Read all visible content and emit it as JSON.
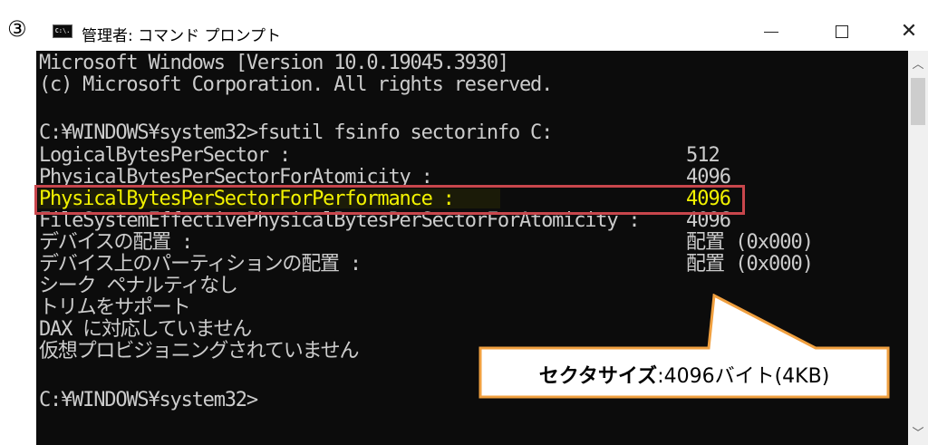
{
  "annotation": {
    "step": "③",
    "callout_bold": "セクタサイズ",
    "callout_rest": ":4096バイト(4KB)"
  },
  "window": {
    "title": "管理者: コマンド プロンプト",
    "icon": "cmd-icon",
    "icon_text": "C:\\."
  },
  "console": {
    "lines": [
      "Microsoft Windows [Version 10.0.19045.3930]",
      "(c) Microsoft Corporation. All rights reserved.",
      "",
      "C:¥WINDOWS¥system32>fsutil fsinfo sectorinfo C:",
      "LogicalBytesPerSector :",
      "PhysicalBytesPerSectorForAtomicity :",
      "PhysicalBytesPerSectorForPerformance :",
      "FileSystemEffectivePhysicalBytesPerSectorForAtomicity :",
      "デバイスの配置 :",
      "デバイス上のパーティションの配置 :",
      "シーク ペナルティなし",
      "トリムをサポート",
      "DAX に対応していません",
      "仮想プロビジョニングされていません",
      "",
      "C:¥WINDOWS¥system32>"
    ],
    "values": [
      "512",
      "4096",
      "4096",
      "4096",
      "配置 (0x000)",
      "配置 (0x000)"
    ]
  },
  "colors": {
    "console_bg": "#0c0c0c",
    "console_text": "#cccccc",
    "highlight_text": "#f2f200",
    "frame": "#c8464c",
    "callout_border": "#f0a040"
  }
}
